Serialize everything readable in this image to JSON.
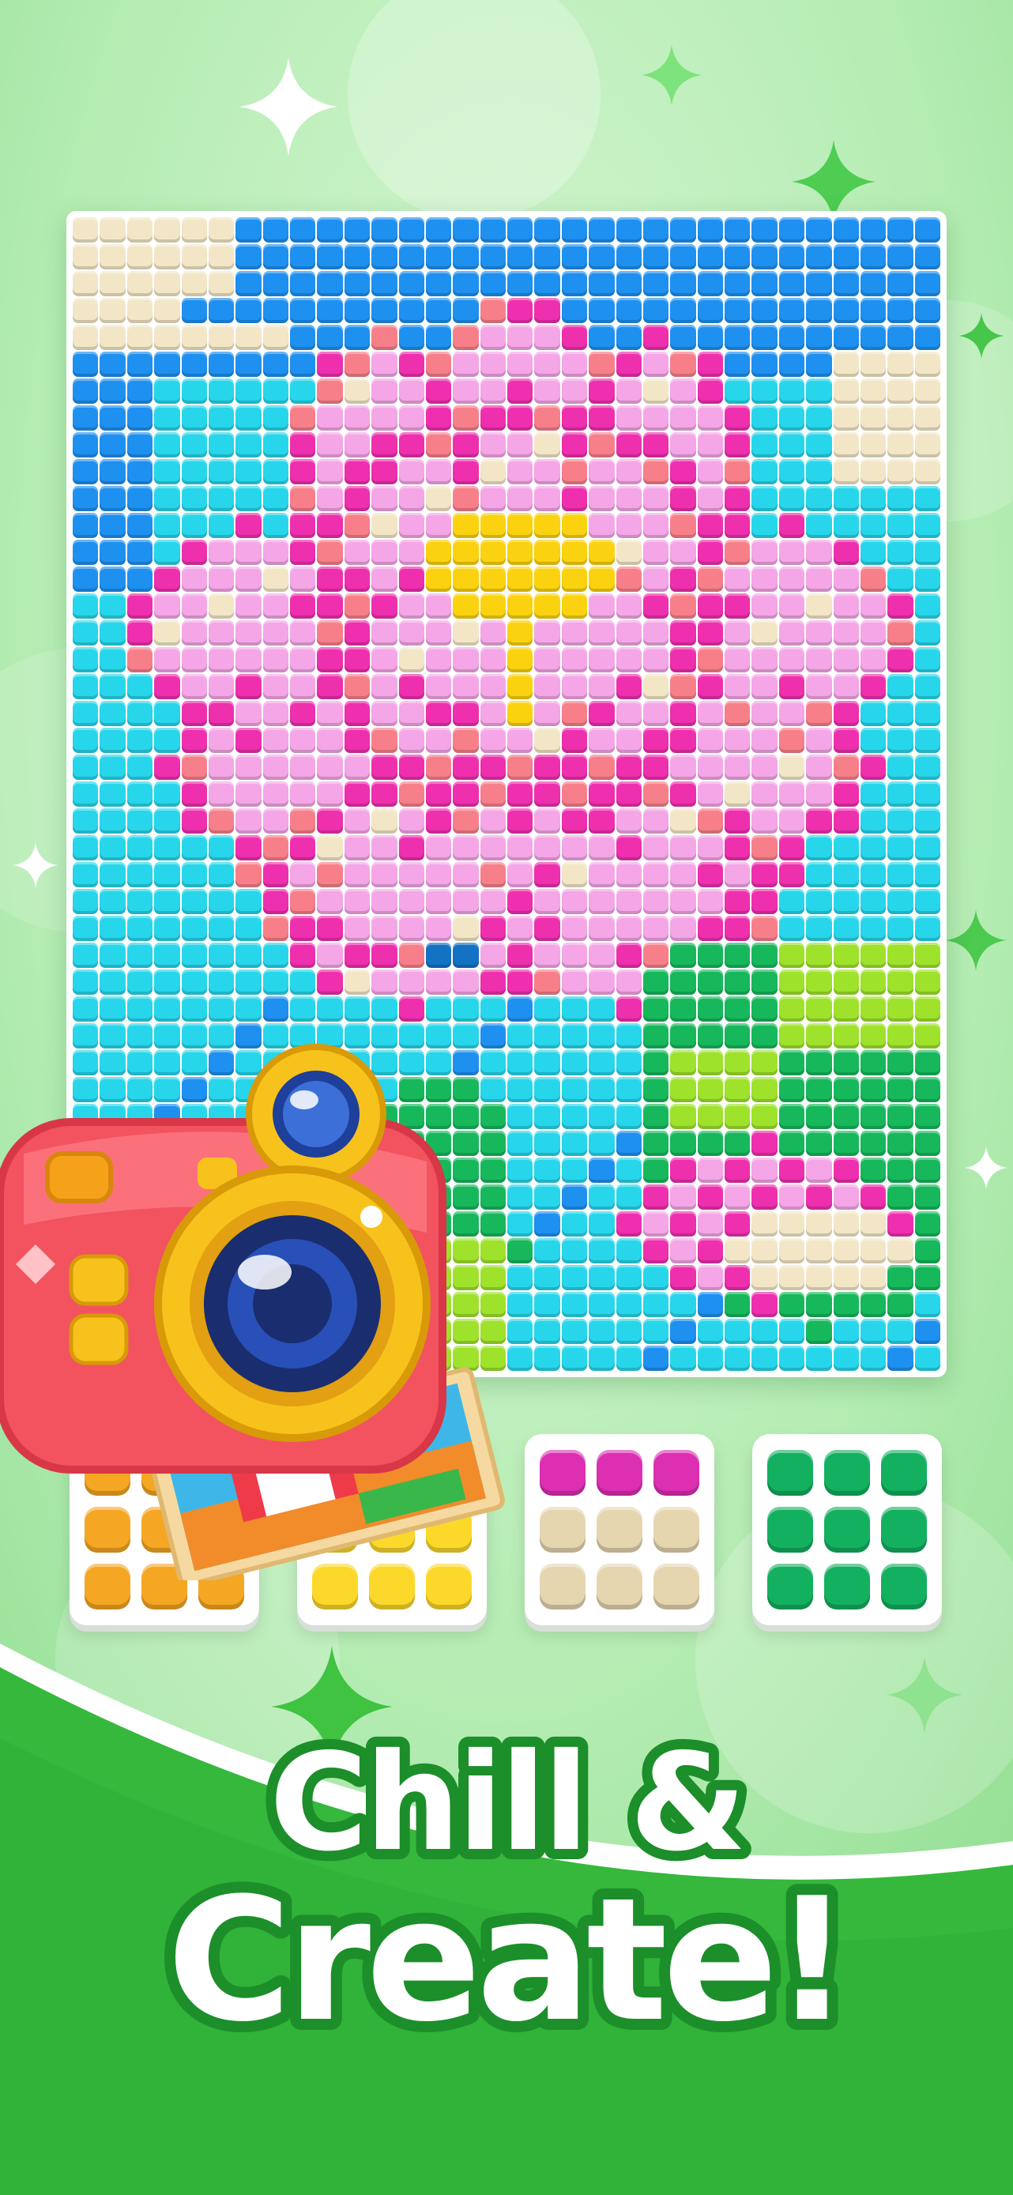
{
  "headline": {
    "line1": "Chill &",
    "line2": "Create!"
  },
  "colors": {
    "background_light": "#bff2bf",
    "background_mid": "#8ee08f",
    "band_green": "#35b83c",
    "text_fill": "#ffffff",
    "text_outline": "#1c8e2a"
  },
  "board": {
    "columns": 32,
    "rows": 43,
    "legend": {
      "S": "#1e90f0",
      "T": "#f2e6c6",
      "C": "#27d6ea",
      "M": "#ee2fae",
      "P": "#f4a6e6",
      "O": "#f77f8a",
      "Y": "#fbd20f",
      "G": "#16b85b",
      "L": "#9ee22c",
      "D": "#1372c4",
      "B": "#5ab8f3",
      "W": "#ffffff"
    }
  },
  "palettes": [
    {
      "rows": [
        "#f5a623",
        "#f5a623",
        "#f5a623"
      ],
      "top": "#f5a623",
      "icon": "orange-bead-palette"
    },
    {
      "rows": [
        "#fcd82a",
        "#fcd82a",
        "#fcd82a"
      ],
      "top": "#fcd82a",
      "icon": "yellow-bead-palette"
    },
    {
      "rows": [
        "#dd2fb2",
        "#e5d6b0",
        "#e5d6b0"
      ],
      "top": "#dd2fb2",
      "icon": "pink-tan-bead-palette"
    },
    {
      "rows": [
        "#13b060",
        "#13b060",
        "#13b060"
      ],
      "top": "#13b060",
      "icon": "green-bead-palette"
    }
  ],
  "icons": {
    "camera": "camera-icon",
    "photo": "photo-print-icon",
    "sparkle": "sparkle-icon"
  }
}
